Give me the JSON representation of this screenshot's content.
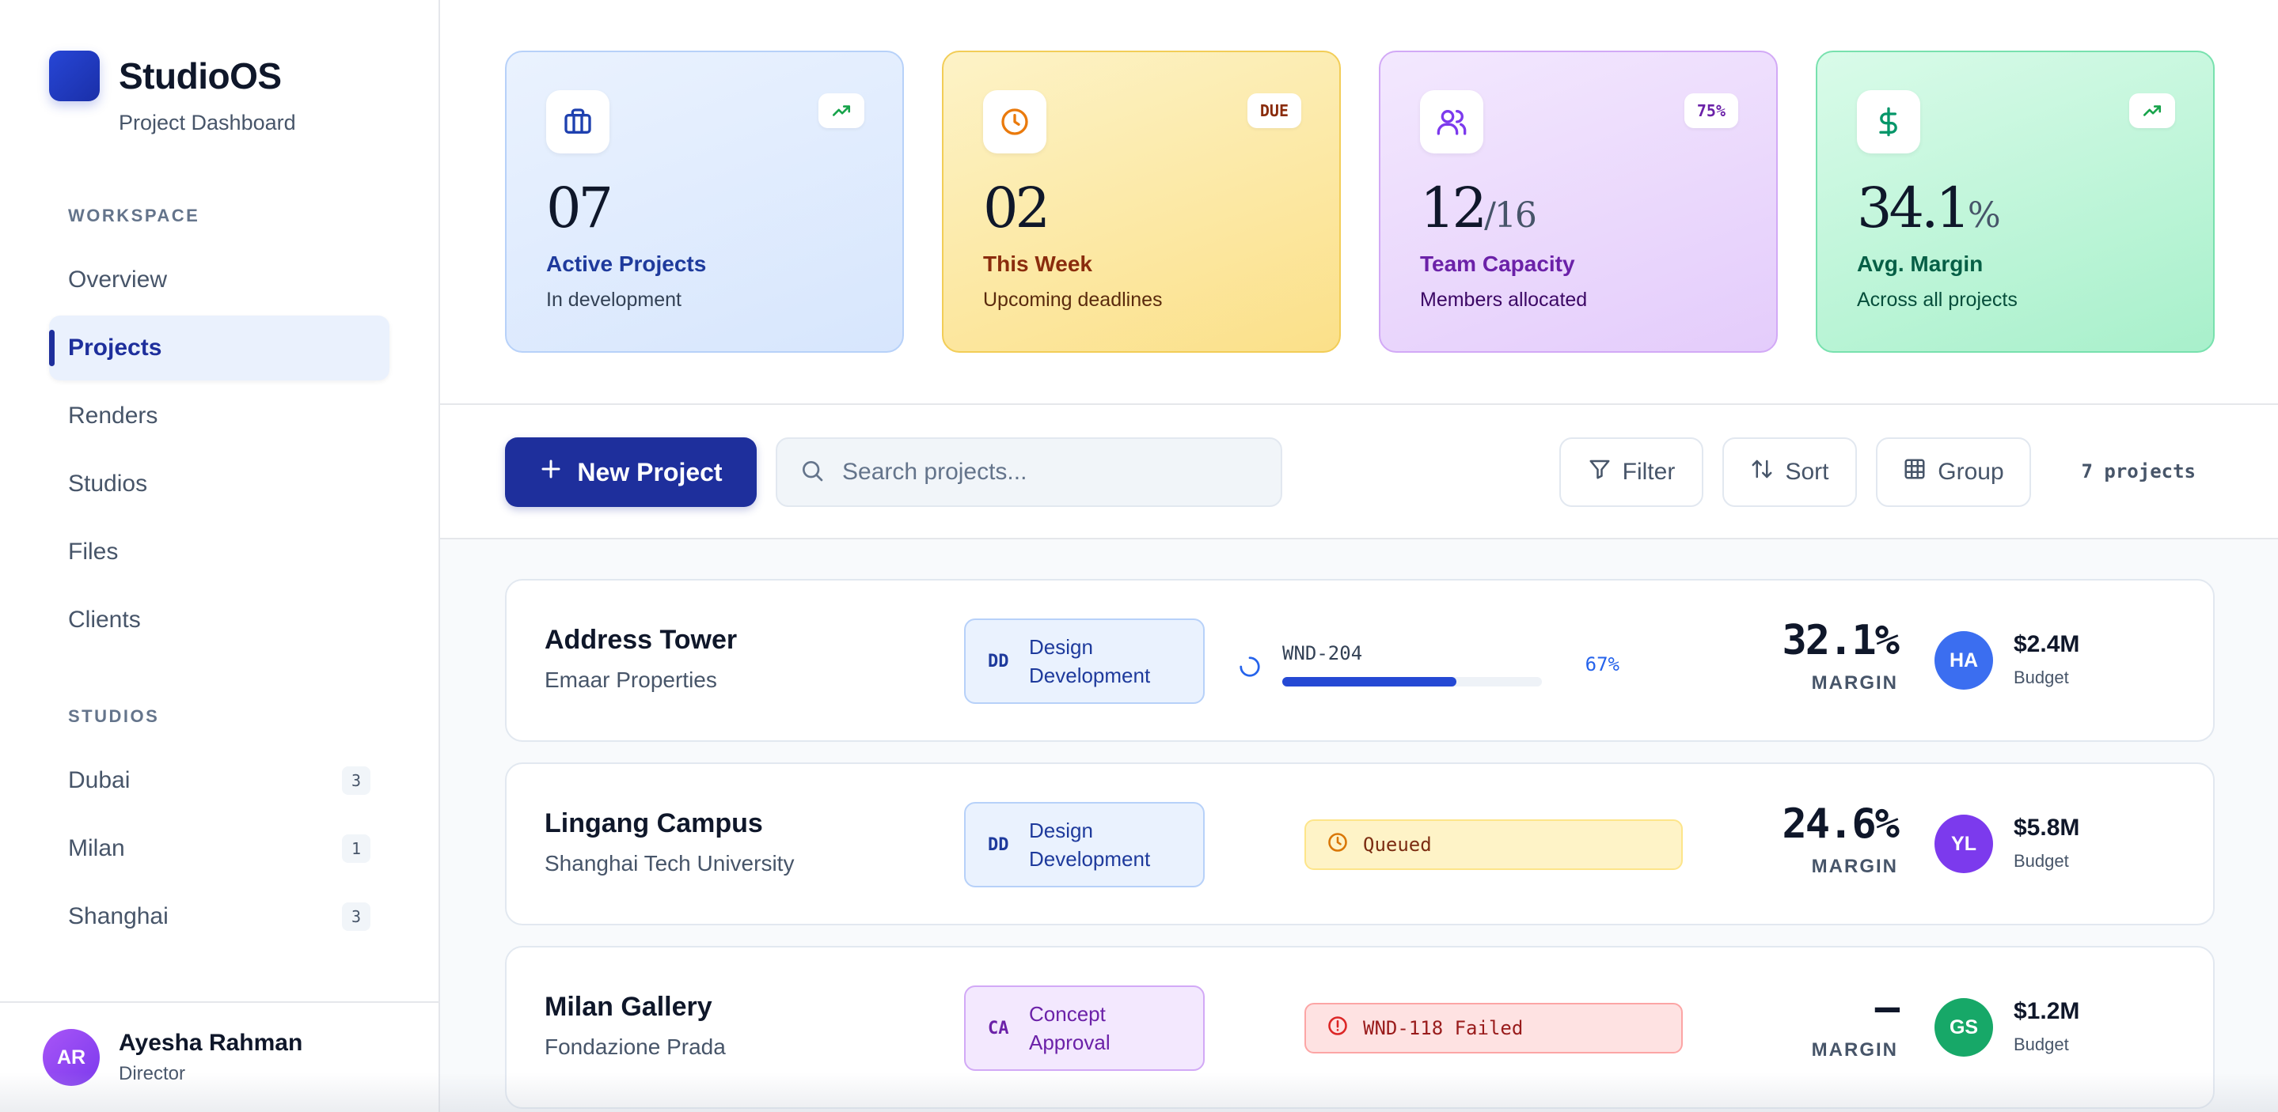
{
  "app": {
    "name": "StudioOS",
    "subtitle": "Project Dashboard"
  },
  "sidebar": {
    "workspace_label": "WORKSPACE",
    "nav": [
      {
        "label": "Overview",
        "active": false
      },
      {
        "label": "Projects",
        "active": true
      },
      {
        "label": "Renders",
        "active": false
      },
      {
        "label": "Studios",
        "active": false
      },
      {
        "label": "Files",
        "active": false
      },
      {
        "label": "Clients",
        "active": false
      }
    ],
    "studios_label": "STUDIOS",
    "studios": [
      {
        "label": "Dubai",
        "count": "3"
      },
      {
        "label": "Milan",
        "count": "1"
      },
      {
        "label": "Shanghai",
        "count": "3"
      }
    ],
    "user": {
      "initials": "AR",
      "name": "Ayesha Rahman",
      "role": "Director"
    }
  },
  "stats": [
    {
      "icon": "briefcase-icon",
      "tag": "trending-up-icon",
      "value": "07",
      "value_suffix": "",
      "title": "Active Projects",
      "desc": "In development"
    },
    {
      "icon": "clock-icon",
      "tag": "DUE",
      "value": "02",
      "value_suffix": "",
      "title": "This Week",
      "desc": "Upcoming deadlines"
    },
    {
      "icon": "users-icon",
      "tag": "75%",
      "value": "12",
      "value_suffix": "/16",
      "title": "Team Capacity",
      "desc": "Members allocated"
    },
    {
      "icon": "dollar-icon",
      "tag": "trending-up-icon",
      "value": "34.1",
      "value_suffix": "%",
      "title": "Avg. Margin",
      "desc": "Across all projects"
    }
  ],
  "toolbar": {
    "new_project": "New Project",
    "search_placeholder": "Search projects...",
    "filter": "Filter",
    "sort": "Sort",
    "group": "Group",
    "count": "7 projects"
  },
  "projects": [
    {
      "name": "Address Tower",
      "client": "Emaar Properties",
      "phase_code": "DD",
      "phase_label": "Design Development",
      "status_type": "progress",
      "render_code": "WND-204",
      "progress": 0.67,
      "progress_label": "67%",
      "margin": "32.1%",
      "margin_label": "MARGIN",
      "owner_initials": "HA",
      "owner_color": "#3b6ef0",
      "budget": "$2.4M",
      "budget_label": "Budget"
    },
    {
      "name": "Lingang Campus",
      "client": "Shanghai Tech University",
      "phase_code": "DD",
      "phase_label": "Design Development",
      "status_type": "queued",
      "status_text": "Queued",
      "margin": "24.6%",
      "margin_label": "MARGIN",
      "owner_initials": "YL",
      "owner_color": "#7c3aed",
      "budget": "$5.8M",
      "budget_label": "Budget"
    },
    {
      "name": "Milan Gallery",
      "client": "Fondazione Prada",
      "phase_code": "CA",
      "phase_label": "Concept Approval",
      "status_type": "failed",
      "status_text": "WND-118 Failed",
      "margin": "—",
      "margin_label": "MARGIN",
      "owner_initials": "GS",
      "owner_color": "#17a868",
      "budget": "$1.2M",
      "budget_label": "Budget"
    }
  ],
  "colors": {
    "accent": "#1e2f9c",
    "progress": "#2549d4"
  }
}
